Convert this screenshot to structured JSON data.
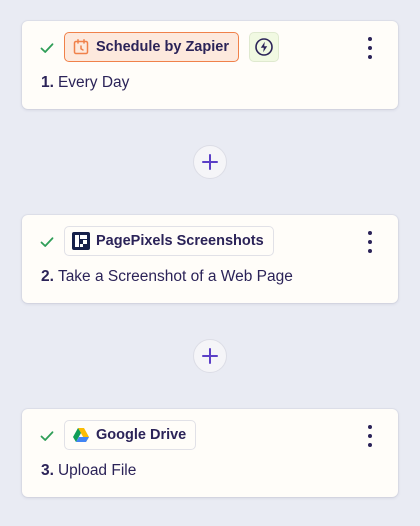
{
  "steps": [
    {
      "number": "1.",
      "title": "Every Day",
      "app": "Schedule by Zapier",
      "status": "complete",
      "app_icon": "calendar-clock-icon",
      "extra_icon": "lightning-icon"
    },
    {
      "number": "2.",
      "title": "Take a Screenshot of a Web Page",
      "app": "PagePixels Screenshots",
      "status": "complete",
      "app_icon": "pagepixels-logo-icon"
    },
    {
      "number": "3.",
      "title": "Upload File",
      "app": "Google Drive",
      "status": "complete",
      "app_icon": "google-drive-icon"
    }
  ],
  "colors": {
    "background": "#e9ebf3",
    "card": "#fffdf9",
    "text": "#2b2358",
    "check": "#2f9e58",
    "add_icon": "#5b3fc7",
    "schedule_accent": "#f0814a",
    "bolt_bg": "#f1f9e2"
  }
}
